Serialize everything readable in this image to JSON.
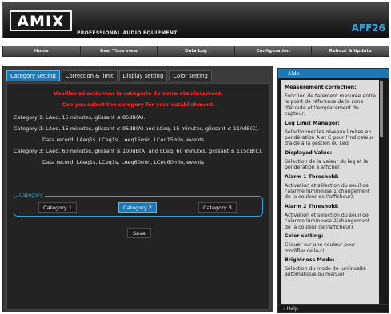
{
  "header": {
    "logo": "AMIX",
    "tagline": "PROFESSIONAL AUDIO EQUIPMENT",
    "model": "AFF26"
  },
  "nav": [
    "Home",
    "Real Time view",
    "Data Log",
    "Configuration",
    "Reboot & Update"
  ],
  "tabs": [
    "Category setting",
    "Correction & limit",
    "Display setting",
    "Color setting"
  ],
  "active_tab": "Category setting",
  "warnings": [
    "Veuillez sélectionner la catégorie de votre établissement.",
    "Can you select the category for your establishment."
  ],
  "categories_text": [
    "Category 1: LAeq, 15 minutes, glissant ≤ 85dB(A).",
    "Category 2: LAeq, 15 minutes, glissant ≤ 95dB(A) and LCeq, 15 minutes, glissant ≤ 110dB(C).",
    "Data record: LAeq1s, LCeq1s, LAeq15min, LCeq15min, events",
    "Category 3: LAeq, 60 minutes, glissant ≤ 100dB(A) and LCeq, 60 minutes, glissant ≤ 115dB(C).",
    "Data record: LAeq1s, LCeq1s, LAeq60min, LCeq60min, events"
  ],
  "category_group": {
    "legend": "Category",
    "options": [
      "Category 1",
      "Category 2",
      "Category 3"
    ],
    "selected": "Category 2"
  },
  "save_label": "Save",
  "help": {
    "title": "Aide",
    "footer": "Help",
    "sections": [
      {
        "title": "Measurement correction:",
        "text": "Fonction de tarement mesurée entre le point de référence de la zone d'écoute et l'emplacement du capteur."
      },
      {
        "title": "Leq Limit Manager:",
        "text": "Selectionner les niveaux limites en pondération A et C pour l'indicateur d'aide à la gestion du Leq"
      },
      {
        "title": "Displayed Value:",
        "text": "Sélection de la valeur du leq et la pondération à afficher."
      },
      {
        "title": "Alarm 1 Threshold:",
        "text": "Activation et sélection du seuil de l'alarme lumineuse 1(changement de la couleur de l'afficheur)."
      },
      {
        "title": "Alarm 2 Threshold:",
        "text": "Activation et sélection du seuil de l'alarme lumineuse 2(changement de la couleur de l'afficheur)."
      },
      {
        "title": "Color setting:",
        "text": "Cliquer sur une couleur pour modifier celle-ci."
      },
      {
        "title": "Brightness Mode:",
        "text": "Sélection du mode de luminosité automatique ou manuel"
      }
    ]
  }
}
